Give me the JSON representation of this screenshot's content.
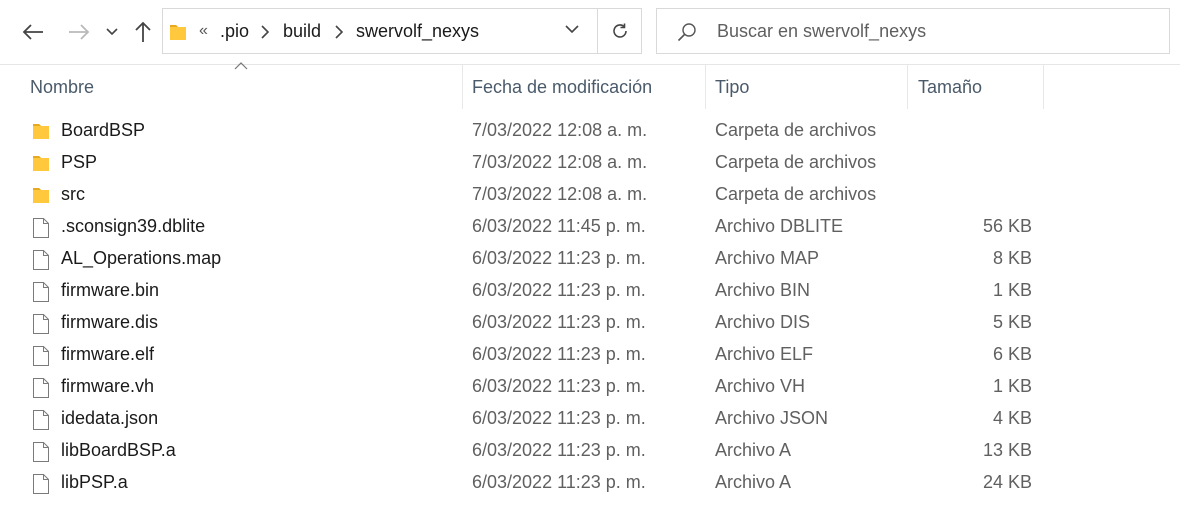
{
  "toolbar": {
    "back_icon": "arrow-left-icon",
    "forward_icon": "arrow-right-icon",
    "recent_icon": "chevron-down-icon",
    "up_icon": "arrow-up-icon",
    "refresh_icon": "refresh-icon"
  },
  "address": {
    "overflow": "«",
    "crumbs": [
      ".pio",
      "build",
      "swervolf_nexys"
    ]
  },
  "search": {
    "placeholder": "Buscar en swervolf_nexys"
  },
  "columns": {
    "name": "Nombre",
    "date": "Fecha de modificación",
    "type": "Tipo",
    "size": "Tamaño"
  },
  "files": [
    {
      "name": "BoardBSP",
      "date": "7/03/2022 12:08 a. m.",
      "type": "Carpeta de archivos",
      "size": "",
      "kind": "folder"
    },
    {
      "name": "PSP",
      "date": "7/03/2022 12:08 a. m.",
      "type": "Carpeta de archivos",
      "size": "",
      "kind": "folder"
    },
    {
      "name": "src",
      "date": "7/03/2022 12:08 a. m.",
      "type": "Carpeta de archivos",
      "size": "",
      "kind": "folder"
    },
    {
      "name": ".sconsign39.dblite",
      "date": "6/03/2022 11:45 p. m.",
      "type": "Archivo DBLITE",
      "size": "56 KB",
      "kind": "file"
    },
    {
      "name": "AL_Operations.map",
      "date": "6/03/2022 11:23 p. m.",
      "type": "Archivo MAP",
      "size": "8 KB",
      "kind": "file"
    },
    {
      "name": "firmware.bin",
      "date": "6/03/2022 11:23 p. m.",
      "type": "Archivo BIN",
      "size": "1 KB",
      "kind": "file"
    },
    {
      "name": "firmware.dis",
      "date": "6/03/2022 11:23 p. m.",
      "type": "Archivo DIS",
      "size": "5 KB",
      "kind": "file"
    },
    {
      "name": "firmware.elf",
      "date": "6/03/2022 11:23 p. m.",
      "type": "Archivo ELF",
      "size": "6 KB",
      "kind": "file"
    },
    {
      "name": "firmware.vh",
      "date": "6/03/2022 11:23 p. m.",
      "type": "Archivo VH",
      "size": "1 KB",
      "kind": "file"
    },
    {
      "name": "idedata.json",
      "date": "6/03/2022 11:23 p. m.",
      "type": "Archivo JSON",
      "size": "4 KB",
      "kind": "file"
    },
    {
      "name": "libBoardBSP.a",
      "date": "6/03/2022 11:23 p. m.",
      "type": "Archivo A",
      "size": "13 KB",
      "kind": "file"
    },
    {
      "name": "libPSP.a",
      "date": "6/03/2022 11:23 p. m.",
      "type": "Archivo A",
      "size": "24 KB",
      "kind": "file"
    }
  ],
  "colors": {
    "folder": "#ffc83d",
    "folder_dark": "#e8a820",
    "border": "#d9d9d9",
    "header_text": "#4a5a6a"
  }
}
